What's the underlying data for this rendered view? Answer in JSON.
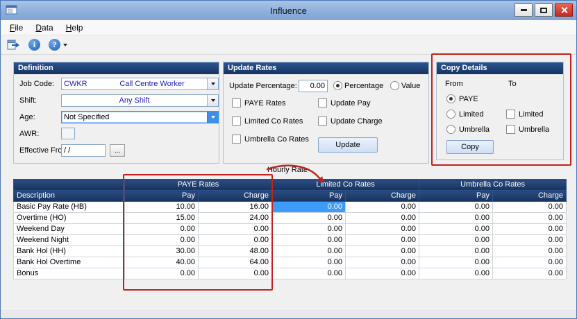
{
  "window": {
    "title": "Influence"
  },
  "menu": {
    "items": [
      "File",
      "Data",
      "Help"
    ]
  },
  "toolbar": {
    "info_glyph": "i",
    "help_glyph": "?"
  },
  "definition": {
    "header": "Definition",
    "job_code": {
      "label": "Job Code:",
      "code": "CWKR",
      "description": "Call Centre Worker"
    },
    "shift": {
      "label": "Shift:",
      "value": "Any Shift"
    },
    "age": {
      "label": "Age:",
      "value": "Not Specified"
    },
    "awr": {
      "label": "AWR:",
      "value": ""
    },
    "effective_from": {
      "label": "Effective From:",
      "value": "/  /",
      "browse": "..."
    }
  },
  "update_rates": {
    "header": "Update Rates",
    "percentage": {
      "label": "Update Percentage:",
      "value": "0.00"
    },
    "radios": [
      "Percentage",
      "Value"
    ],
    "selected_radio": "Percentage",
    "rate_checkboxes": [
      "PAYE Rates",
      "Limited Co Rates",
      "Umbrella Co Rates"
    ],
    "update_checkboxes": [
      "Update Pay",
      "Update Charge"
    ],
    "update_button": "Update"
  },
  "copy_details": {
    "header": "Copy Details",
    "from_label": "From",
    "to_label": "To",
    "from_options": [
      "PAYE",
      "Limited",
      "Umbrella"
    ],
    "selected_from": "PAYE",
    "to_options": [
      "Limited",
      "Umbrella"
    ],
    "copy_button": "Copy"
  },
  "table": {
    "caption": "Hourly Rate",
    "description_header": "Description",
    "groups": [
      "PAYE Rates",
      "Limited Co Rates",
      "Umbrella Co Rates"
    ],
    "sub_headers": [
      "Pay",
      "Charge"
    ],
    "selected_cell": {
      "row": 0,
      "column": "Limited Co Rates Pay"
    },
    "rows": [
      {
        "description": "Basic Pay Rate (HB)",
        "values": [
          "10.00",
          "16.00",
          "0.00",
          "0.00",
          "0.00",
          "0.00"
        ]
      },
      {
        "description": "Overtime (HO)",
        "values": [
          "15.00",
          "24.00",
          "0.00",
          "0.00",
          "0.00",
          "0.00"
        ]
      },
      {
        "description": "Weekend Day",
        "values": [
          "0.00",
          "0.00",
          "0.00",
          "0.00",
          "0.00",
          "0.00"
        ]
      },
      {
        "description": "Weekend Night",
        "values": [
          "0.00",
          "0.00",
          "0.00",
          "0.00",
          "0.00",
          "0.00"
        ]
      },
      {
        "description": "Bank Hol (HH)",
        "values": [
          "30.00",
          "48.00",
          "0.00",
          "0.00",
          "0.00",
          "0.00"
        ]
      },
      {
        "description": "Bank Hol Overtime",
        "values": [
          "40.00",
          "64.00",
          "0.00",
          "0.00",
          "0.00",
          "0.00"
        ]
      },
      {
        "description": "Bonus",
        "values": [
          "0.00",
          "0.00",
          "0.00",
          "0.00",
          "0.00",
          "0.00"
        ]
      }
    ]
  },
  "colors": {
    "accent_navy": "#17355e",
    "selection_blue": "#3d9bfa",
    "annotation_red": "#c0231d"
  }
}
